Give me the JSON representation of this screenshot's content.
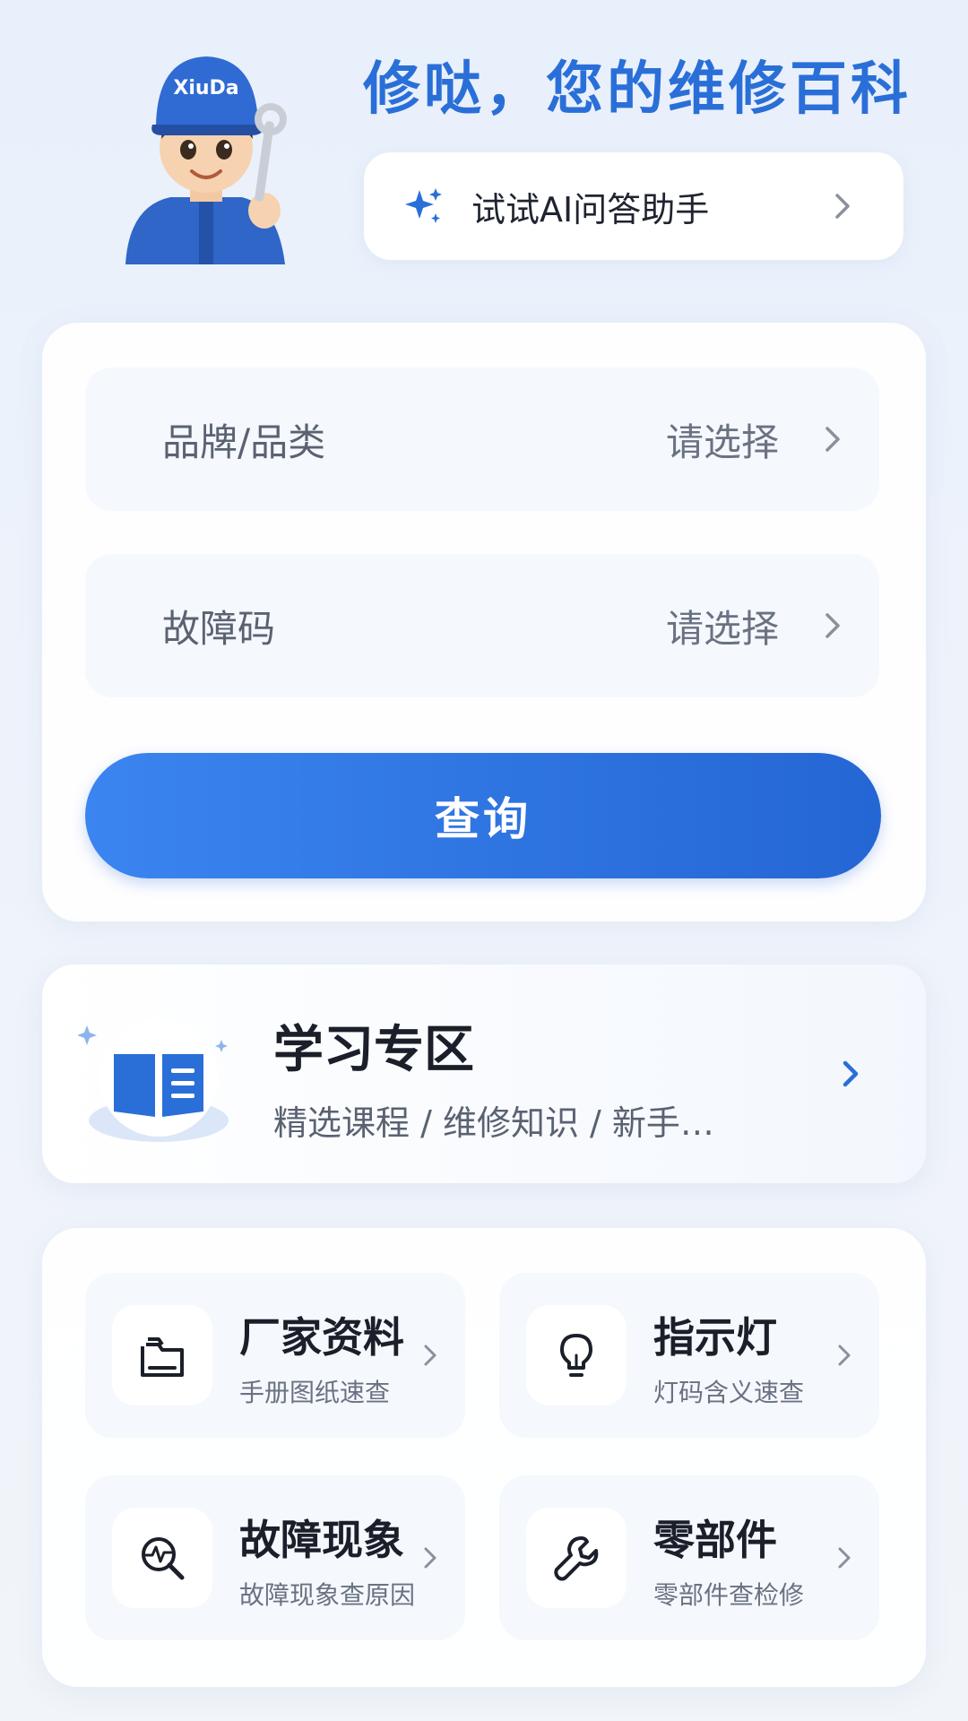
{
  "header": {
    "mascot_badge": "XiuDa",
    "headline": "修哒，您的维修百科",
    "ai_assistant_label": "试试AI问答助手"
  },
  "search": {
    "fields": [
      {
        "label": "品牌/品类",
        "value": "请选择"
      },
      {
        "label": "故障码",
        "value": "请选择"
      }
    ],
    "query_label": "查询"
  },
  "learning": {
    "title": "学习专区",
    "subtitle": "精选课程 / 维修知识 / 新手…"
  },
  "tools": [
    {
      "title": "厂家资料",
      "subtitle": "手册图纸速查",
      "icon": "folder-icon"
    },
    {
      "title": "指示灯",
      "subtitle": "灯码含义速查",
      "icon": "lightbulb-icon"
    },
    {
      "title": "故障现象",
      "subtitle": "故障现象查原因",
      "icon": "diagnostic-search-icon"
    },
    {
      "title": "零部件",
      "subtitle": "零部件查检修",
      "icon": "wrench-icon"
    }
  ],
  "colors": {
    "accent": "#2a6fd8",
    "button_start": "#3b85f0",
    "button_end": "#2466d4",
    "background": "#eef3fb"
  }
}
